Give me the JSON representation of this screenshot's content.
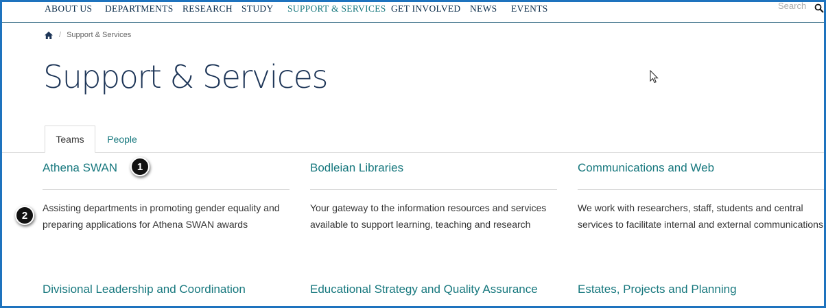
{
  "nav": {
    "items": [
      "ABOUT US",
      "DEPARTMENTS",
      "RESEARCH",
      "STUDY",
      "SUPPORT & SERVICES",
      "GET INVOLVED",
      "NEWS",
      "EVENTS"
    ],
    "active": "SUPPORT & SERVICES",
    "search_placeholder": "Search"
  },
  "breadcrumb": {
    "separator": "/",
    "current": "Support & Services"
  },
  "page": {
    "title": "Support & Services"
  },
  "tabs": [
    {
      "label": "Teams",
      "active": true
    },
    {
      "label": "People",
      "active": false
    }
  ],
  "teams": [
    {
      "name": "Athena SWAN",
      "description": "Assisting departments in promoting gender equality and preparing applications for Athena SWAN awards"
    },
    {
      "name": "Bodleian Libraries",
      "description": "Your gateway to the information resources and services available to support learning, teaching and research"
    },
    {
      "name": "Communications and Web",
      "description": "We work with researchers, staff, students and central services to facilitate internal and external communications"
    },
    {
      "name": "Divisional Leadership and Coordination"
    },
    {
      "name": "Educational Strategy and Quality Assurance"
    },
    {
      "name": "Estates, Projects and Planning"
    }
  ],
  "annotations": [
    "1",
    "2"
  ],
  "colors": {
    "accent": "#17787e",
    "nav_text": "#0b2c4a",
    "title": "#1d3557",
    "frame": "#1e73be"
  }
}
